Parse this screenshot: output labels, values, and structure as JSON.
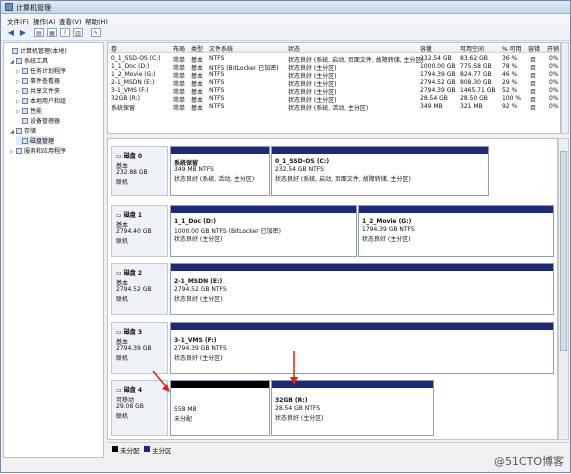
{
  "window": {
    "title": "计算机管理"
  },
  "menu": [
    "文件(F)",
    "操作(A)",
    "查看(V)",
    "帮助(H)"
  ],
  "tree": [
    {
      "label": "计算机管理(本地)",
      "indent": 0,
      "exp": ""
    },
    {
      "label": "系统工具",
      "indent": 1,
      "exp": "◢"
    },
    {
      "label": "任务计划程序",
      "indent": 2,
      "exp": "▷"
    },
    {
      "label": "事件查看器",
      "indent": 2,
      "exp": "▷"
    },
    {
      "label": "共享文件夹",
      "indent": 2,
      "exp": "▷"
    },
    {
      "label": "本地用户和组",
      "indent": 2,
      "exp": "▷"
    },
    {
      "label": "性能",
      "indent": 2,
      "exp": "▷"
    },
    {
      "label": "设备管理器",
      "indent": 2,
      "exp": ""
    },
    {
      "label": "存储",
      "indent": 1,
      "exp": "◢"
    },
    {
      "label": "磁盘管理",
      "indent": 2,
      "exp": ""
    },
    {
      "label": "服务和应用程序",
      "indent": 1,
      "exp": "▷"
    }
  ],
  "volume_table": {
    "headers": [
      "卷",
      "布局",
      "类型",
      "文件系统",
      "状态",
      "容量",
      "可用空间",
      "% 可用",
      "容错",
      "开销"
    ],
    "rows": [
      [
        "0_1_SSD-OS (C:)",
        "简单",
        "基本",
        "NTFS",
        "状态良好 (系统, 启动, 页面文件, 故障转储, 主分区)",
        "232.54 GB",
        "83.62 GB",
        "36 %",
        "否",
        "0%"
      ],
      [
        "1_1_Doc (D:)",
        "简单",
        "基本",
        "NTFS (BitLocker 已加密)",
        "状态良好 (主分区)",
        "1000.00 GB",
        "775.58 GB",
        "78 %",
        "否",
        "0%"
      ],
      [
        "1_2_Movie (G:)",
        "简单",
        "基本",
        "NTFS",
        "状态良好 (主分区)",
        "1794.39 GB",
        "824.77 GB",
        "46 %",
        "否",
        "0%"
      ],
      [
        "2-1_MSDN (E:)",
        "简单",
        "基本",
        "NTFS",
        "状态良好 (主分区)",
        "2794.52 GB",
        "808.30 GB",
        "29 %",
        "否",
        "0%"
      ],
      [
        "3-1_VMS (F:)",
        "简单",
        "基本",
        "NTFS",
        "状态良好 (主分区)",
        "2794.39 GB",
        "1465.71 GB",
        "52 %",
        "否",
        "0%"
      ],
      [
        "32GB (R:)",
        "简单",
        "基本",
        "NTFS",
        "状态良好 (主分区)",
        "28.54 GB",
        "28.50 GB",
        "100 %",
        "否",
        "0%"
      ],
      [
        "系统保留",
        "简单",
        "基本",
        "NTFS",
        "状态良好 (系统, 活动, 主分区)",
        "349 MB",
        "321 MB",
        "92 %",
        "否",
        "0%"
      ]
    ]
  },
  "disks": [
    {
      "name": "磁盘 0",
      "type": "基本",
      "size": "232.88 GB",
      "status": "联机",
      "parts": [
        {
          "name": "系统保留",
          "size": "349 MB NTFS",
          "status": "状态良好 (系统, 活动, 主分区)",
          "bar": "blue"
        },
        {
          "name": "0_1_SSD-OS  (C:)",
          "size": "232.54 GB NTFS",
          "status": "状态良好 (系统, 启动, 页面文件, 故障转储, 主分区)",
          "bar": "blue"
        }
      ]
    },
    {
      "name": "磁盘 1",
      "type": "基本",
      "size": "2794.40 GB",
      "status": "联机",
      "parts": [
        {
          "name": "1_1_Doc  (D:)",
          "size": "1000.00 GB NTFS (BitLocker 已加密)",
          "status": "状态良好 (主分区)",
          "bar": "blue"
        },
        {
          "name": "1_2_Movie  (G:)",
          "size": "1794.39 GB NTFS",
          "status": "状态良好 (主分区)",
          "bar": "blue"
        }
      ]
    },
    {
      "name": "磁盘 2",
      "type": "基本",
      "size": "2794.52 GB",
      "status": "联机",
      "parts": [
        {
          "name": "2-1_MSDN  (E:)",
          "size": "2794.52 GB NTFS",
          "status": "状态良好 (主分区)",
          "bar": "blue"
        }
      ]
    },
    {
      "name": "磁盘 3",
      "type": "基本",
      "size": "2794.39 GB",
      "status": "联机",
      "parts": [
        {
          "name": "3-1_VMS  (F:)",
          "size": "2794.39 GB NTFS",
          "status": "状态良好 (主分区)",
          "bar": "blue"
        }
      ]
    },
    {
      "name": "磁盘 4",
      "type": "可移动",
      "size": "29.08 GB",
      "status": "联机",
      "parts": [
        {
          "name": "",
          "size": "558 MB",
          "status": "未分配",
          "bar": "black"
        },
        {
          "name": "32GB  (R:)",
          "size": "28.54 GB NTFS",
          "status": "状态良好 (主分区)",
          "bar": "blue"
        }
      ]
    }
  ],
  "legend": [
    {
      "label": "未分配",
      "color": "#000000"
    },
    {
      "label": "主分区",
      "color": "#1d2a7a"
    }
  ],
  "watermark": "@51CTO博客",
  "colors": {
    "partition_bar": "#1d2a7a",
    "unallocated": "#000000",
    "arrow": "#e0241b"
  }
}
